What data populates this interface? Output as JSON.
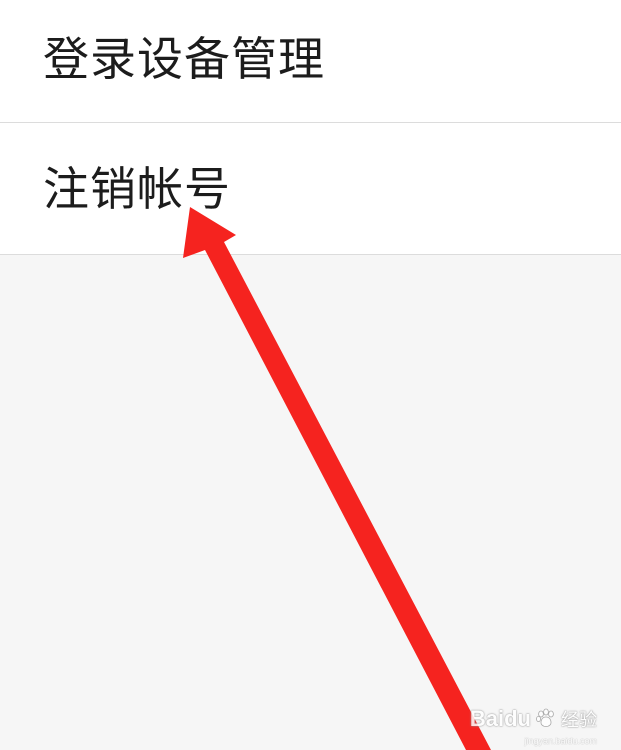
{
  "menu": {
    "items": [
      {
        "label": "登录设备管理"
      },
      {
        "label": "注销帐号"
      }
    ]
  },
  "annotation": {
    "arrow_color": "#f5231f",
    "points_to": "注销帐号"
  },
  "watermark": {
    "brand": "Baidu",
    "service": "经验",
    "domain": "jingyan.baidu.com"
  },
  "colors": {
    "page_background": "#f6f6f6",
    "item_background": "#ffffff",
    "divider": "#dcdcdc",
    "text": "#1c1c1c"
  }
}
